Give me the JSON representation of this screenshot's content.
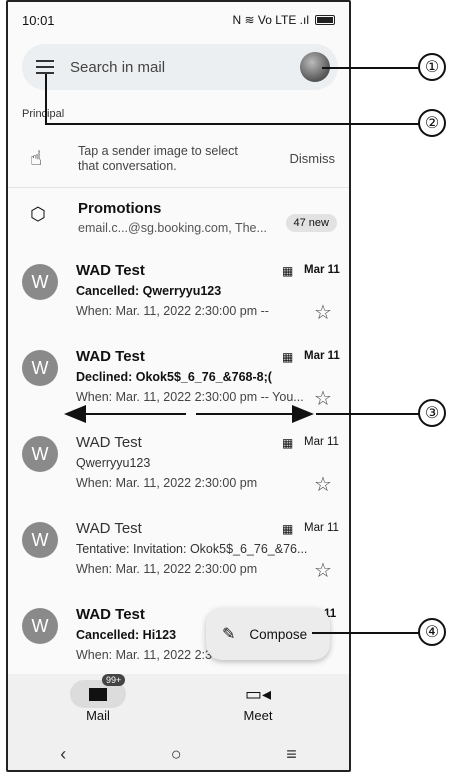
{
  "status": {
    "time": "10:01",
    "icons": "N ≋ Vo LTE .ıl"
  },
  "search": {
    "placeholder": "Search in mail"
  },
  "section_label": "Principal",
  "tip": {
    "text_line1": "Tap a sender image to select",
    "text_line2": "that conversation.",
    "dismiss": "Dismiss"
  },
  "promotions": {
    "title": "Promotions",
    "snippet": "email.c...@sg.booking.com, The...",
    "badge": "47 new"
  },
  "mails": [
    {
      "initial": "W",
      "sender": "WAD Test",
      "subject": "Cancelled: Qwerryyu123",
      "snippet": "When: Mar. 11, 2022 2:30:00 pm --",
      "date": "Mar 11"
    },
    {
      "initial": "W",
      "sender": "WAD Test",
      "subject": "Declined: Okok5$_6_76_&768-8;(",
      "snippet": "When: Mar. 11, 2022 2:30:00 pm -- You...",
      "date": "Mar 11"
    },
    {
      "initial": "W",
      "sender": "WAD Test",
      "subject": "Qwerryyu123",
      "snippet": "When: Mar. 11, 2022 2:30:00 pm",
      "date": "Mar 11"
    },
    {
      "initial": "W",
      "sender": "WAD Test",
      "subject": "Tentative: Invitation: Okok5$_6_76_&76...",
      "snippet": "When: Mar. 11, 2022 2:30:00 pm",
      "date": "Mar 11"
    },
    {
      "initial": "W",
      "sender": "WAD Test",
      "subject": "Cancelled: Hi123",
      "snippet": "When: Mar. 11, 2022 2:3",
      "date": "11"
    }
  ],
  "compose": {
    "label": "Compose"
  },
  "bottom_nav": {
    "mail_label": "Mail",
    "mail_count": "99+",
    "meet_label": "Meet"
  },
  "system_nav": {
    "back": "‹",
    "home": "○",
    "recents": "≡"
  },
  "callouts": [
    "①",
    "②",
    "③",
    "④"
  ]
}
